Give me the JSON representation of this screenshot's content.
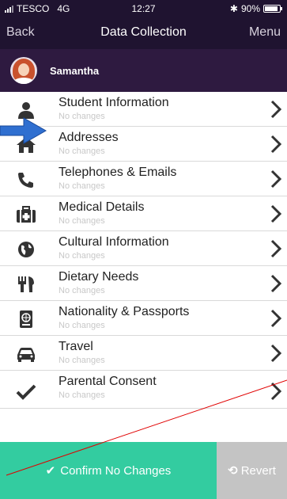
{
  "status_bar": {
    "carrier": "TESCO",
    "network": "4G",
    "time": "12:27",
    "battery": "90%",
    "battery_level": 0.9
  },
  "nav": {
    "back": "Back",
    "title": "Data Collection",
    "menu": "Menu"
  },
  "user": {
    "name": "Samantha"
  },
  "items": [
    {
      "label": "Student Information",
      "status": "No changes",
      "icon": "person-icon"
    },
    {
      "label": "Addresses",
      "status": "No changes",
      "icon": "house-icon"
    },
    {
      "label": "Telephones & Emails",
      "status": "No changes",
      "icon": "phone-icon"
    },
    {
      "label": "Medical Details",
      "status": "No changes",
      "icon": "medical-kit-icon"
    },
    {
      "label": "Cultural Information",
      "status": "No changes",
      "icon": "globe-icon"
    },
    {
      "label": "Dietary Needs",
      "status": "No changes",
      "icon": "cutlery-icon"
    },
    {
      "label": "Nationality & Passports",
      "status": "No changes",
      "icon": "passport-icon"
    },
    {
      "label": "Travel",
      "status": "No changes",
      "icon": "car-icon"
    },
    {
      "label": "Parental Consent",
      "status": "No changes",
      "icon": "checkmark-icon"
    }
  ],
  "actions": {
    "confirm": "Confirm No Changes",
    "revert": "Revert"
  },
  "colors": {
    "header": "#1f1330",
    "user_bar": "#2e1a40",
    "confirm": "#33cca0",
    "revert": "#c4c4c4",
    "callout": "#2f6fd0",
    "annotation": "#e00000"
  }
}
